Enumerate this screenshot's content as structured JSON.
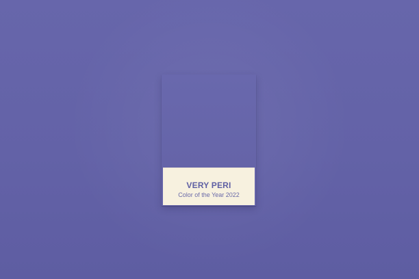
{
  "colors": {
    "background": "#6463a8",
    "swatch": "#6564a8",
    "label_panel": "#f7f1df",
    "label_text": "#5e5fa3"
  },
  "swatch": {
    "name": "VERY PERI",
    "subtitle": "Color of the Year 2022"
  }
}
